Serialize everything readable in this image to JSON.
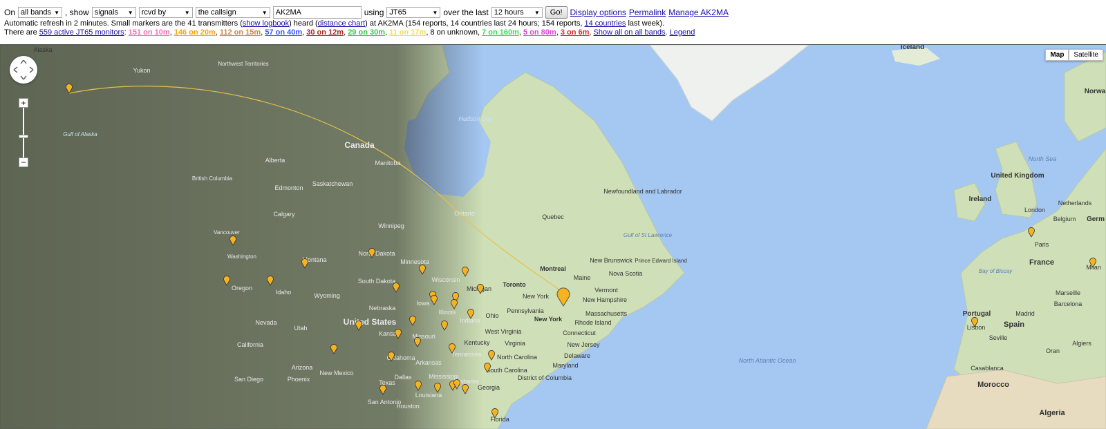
{
  "controls": {
    "on_label": "On",
    "bands_value": "all bands",
    "show_label": ", show",
    "show_value": "signals",
    "direction_value": "rcvd by",
    "callsign_mode_value": "the callsign",
    "callsign_value": "AK2MA",
    "using_label": "using",
    "mode_value": "JT65",
    "over_label": "over the last",
    "period_value": "12 hours",
    "go_label": "Go!",
    "display_options": "Display options",
    "permalink": "Permalink",
    "manage": "Manage AK2MA"
  },
  "info": {
    "refresh_text_1": "Automatic refresh in 2 minutes. Small markers are the 41 transmitters (",
    "show_logbook": "show logbook",
    "refresh_text_2": ") heard (",
    "distance_chart": "distance chart",
    "refresh_text_3": ") at AK2MA (154 reports, 14 countries last 24 hours; 154 reports, ",
    "countries_link": "14 countries",
    "refresh_text_4": " last week)."
  },
  "monitors": {
    "prefix": "There are ",
    "active_link": "559 active JT65 monitors",
    "colon": ": ",
    "bands": [
      {
        "text": "151 on 10m",
        "color": "#ff69b4"
      },
      {
        "text": "146 on 20m",
        "color": "#ffa500"
      },
      {
        "text": "112 on 15m",
        "color": "#cd853f"
      },
      {
        "text": "57 on 40m",
        "color": "#3355ff"
      },
      {
        "text": "30 on 12m",
        "color": "#b22222"
      },
      {
        "text": "29 on 30m",
        "color": "#2ecc40"
      },
      {
        "text": "11 on 17m",
        "color": "#f0e050"
      },
      {
        "text": "7 on 160m",
        "color": "#33dd55"
      },
      {
        "text": "5 on 80m",
        "color": "#dd44dd"
      },
      {
        "text": "3 on 6m",
        "color": "#dd2222"
      }
    ],
    "unknown_text": "8 on unknown",
    "show_all": "Show all on all bands",
    "legend": "Legend"
  },
  "map": {
    "type_map": "Map",
    "type_satellite": "Satellite",
    "zoom_in": "+",
    "zoom_out": "−",
    "labels": {
      "alaska": "Alaska",
      "yukon": "Yukon",
      "northwest_territories": "Northwest Territories",
      "gulf_of_alaska": "Gulf of Alaska",
      "canada": "Canada",
      "alberta": "Alberta",
      "british_columbia": "British Columbia",
      "edmonton": "Edmonton",
      "saskatchewan": "Saskatchewan",
      "manitoba": "Manitoba",
      "calgary": "Calgary",
      "winnipeg": "Winnipeg",
      "ontario": "Ontario",
      "vancouver": "Vancouver",
      "washington": "Washington",
      "montana": "Montana",
      "oregon": "Oregon",
      "idaho": "Idaho",
      "wyoming": "Wyoming",
      "north_dakota": "North Dakota",
      "south_dakota": "South Dakota",
      "minnesota": "Minnesota",
      "wisconsin": "Wisconsin",
      "michigan": "Michigan",
      "nebraska": "Nebraska",
      "iowa": "Iowa",
      "illinois": "Illinois",
      "indiana": "Indiana",
      "ohio": "Ohio",
      "united_states": "United States",
      "nevada": "Nevada",
      "utah": "Utah",
      "california": "California",
      "kansas": "Kansas",
      "missouri": "Missouri",
      "kentucky": "Kentucky",
      "tennessee": "Tennessee",
      "oklahoma": "Oklahoma",
      "arkansas": "Arkansas",
      "arizona": "Arizona",
      "new_mexico": "New Mexico",
      "texas": "Texas",
      "dallas": "Dallas",
      "alabama": "Alabama",
      "georgia": "Georgia",
      "houston": "Houston",
      "san_antonio": "San Antonio",
      "san_diego": "San Diego",
      "phoenix": "Phoenix",
      "florida": "Florida",
      "mississippi": "Mississippi",
      "louisiana": "Louisiana",
      "hudson_bay": "Hudson Bay",
      "quebec": "Quebec",
      "newfoundland": "Newfoundland and Labrador",
      "gulf_st_lawrence": "Gulf of St Lawrence",
      "montreal": "Montreal",
      "toronto": "Toronto",
      "new_brunswick": "New Brunswick",
      "prince_edward_island": "Prince Edward Island",
      "nova_scotia": "Nova Scotia",
      "maine": "Maine",
      "vermont": "Vermont",
      "new_hampshire": "New Hampshire",
      "massachusetts": "Massachusetts",
      "rhode_island": "Rhode Island",
      "connecticut": "Connecticut",
      "new_jersey": "New Jersey",
      "delaware": "Delaware",
      "maryland": "Maryland",
      "district_of_columbia": "District of Columbia",
      "pennsylvania": "Pennsylvania",
      "new_york": "New York",
      "new_york_city": "New York",
      "west_virginia": "West Virginia",
      "virginia": "Virginia",
      "north_carolina": "North Carolina",
      "south_carolina": "South Carolina",
      "iceland": "Iceland",
      "norway": "Norwa",
      "north_sea": "North Sea",
      "united_kingdom": "United Kingdom",
      "ireland": "Ireland",
      "london": "London",
      "netherlands": "Netherlands",
      "belgium": "Belgium",
      "germany": "Germ",
      "paris": "Paris",
      "france": "France",
      "bay_of_biscay": "Bay of Biscay",
      "marseille": "Marseille",
      "milan": "Milan",
      "portugal": "Portugal",
      "spain": "Spain",
      "madrid": "Madrid",
      "barcelona": "Barcelona",
      "lisbon": "Lisbon",
      "seville": "Seville",
      "algiers": "Algiers",
      "oran": "Oran",
      "casablanca": "Casablanca",
      "morocco": "Morocco",
      "algeria": "Algeria",
      "north_atlantic_ocean": "North Atlantic Ocean"
    }
  }
}
